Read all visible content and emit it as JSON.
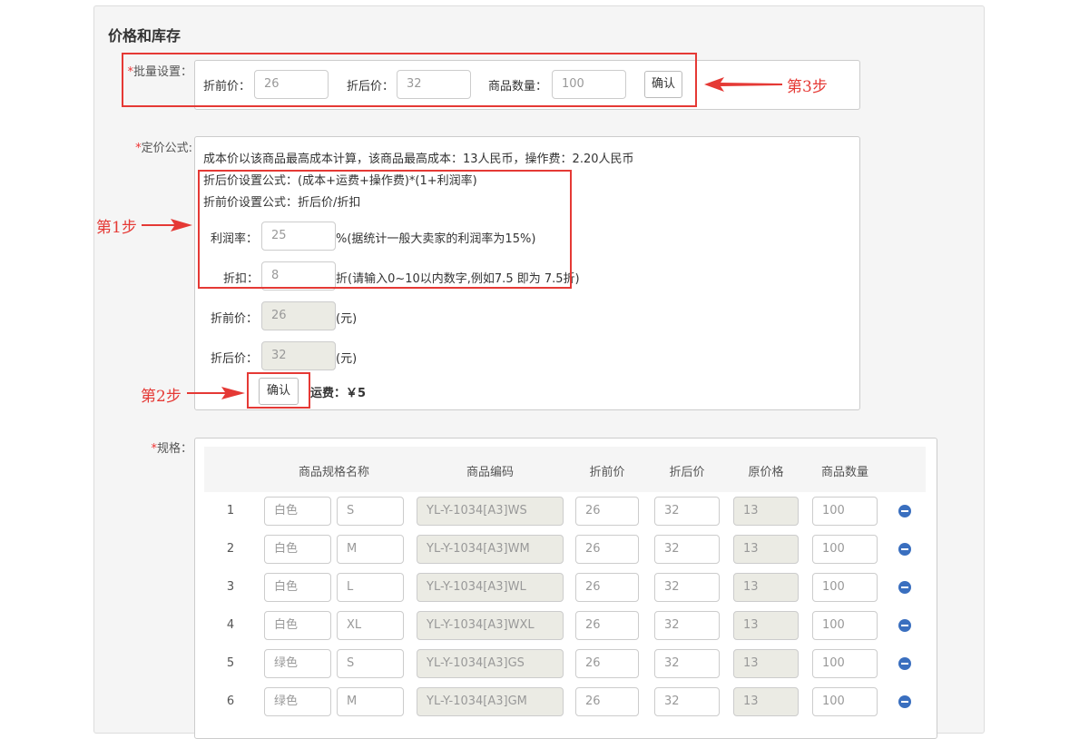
{
  "section_title": "价格和库存",
  "bulk": {
    "label": "批量设置：",
    "orig_label": "折前价：",
    "orig_value": "26",
    "disc_label": "折后价：",
    "disc_value": "32",
    "qty_label": "商品数量：",
    "qty_value": "100",
    "confirm": "确认"
  },
  "formula": {
    "label": "定价公式:",
    "line1": "成本价以该商品最高成本计算，该商品最高成本：13人民币，操作费：2.20人民币",
    "line2": "折后价设置公式：(成本+运费+操作费)*(1+利润率)",
    "line3": "折前价设置公式：折后价/折扣",
    "profit_label": "利润率：",
    "profit_value": "25",
    "profit_note": "%(据统计一般大卖家的利润率为15%)",
    "discount_label": "折扣：",
    "discount_value": "8",
    "discount_note": "折(请输入0~10以内数字,例如7.5 即为 7.5折)",
    "orig_label": "折前价：",
    "orig_value": "26",
    "orig_unit": "(元)",
    "disc_label": "折后价：",
    "disc_value": "32",
    "disc_unit": "(元)",
    "confirm": "确认",
    "shipping": "运费：￥5"
  },
  "steps": {
    "step1": "第1步",
    "step2": "第2步",
    "step3": "第3步"
  },
  "spec": {
    "label": "规格：",
    "headers": [
      "商品规格名称",
      "商品编码",
      "折前价",
      "折后价",
      "原价格",
      "商品数量"
    ],
    "rows": [
      {
        "no": "1",
        "color": "白色",
        "size": "S",
        "code": "YL-Y-1034[A3]WS",
        "orig": "26",
        "disc": "32",
        "price": "13",
        "qty": "100"
      },
      {
        "no": "2",
        "color": "白色",
        "size": "M",
        "code": "YL-Y-1034[A3]WM",
        "orig": "26",
        "disc": "32",
        "price": "13",
        "qty": "100"
      },
      {
        "no": "3",
        "color": "白色",
        "size": "L",
        "code": "YL-Y-1034[A3]WL",
        "orig": "26",
        "disc": "32",
        "price": "13",
        "qty": "100"
      },
      {
        "no": "4",
        "color": "白色",
        "size": "XL",
        "code": "YL-Y-1034[A3]WXL",
        "orig": "26",
        "disc": "32",
        "price": "13",
        "qty": "100"
      },
      {
        "no": "5",
        "color": "绿色",
        "size": "S",
        "code": "YL-Y-1034[A3]GS",
        "orig": "26",
        "disc": "32",
        "price": "13",
        "qty": "100"
      },
      {
        "no": "6",
        "color": "绿色",
        "size": "M",
        "code": "YL-Y-1034[A3]GM",
        "orig": "26",
        "disc": "32",
        "price": "13",
        "qty": "100"
      }
    ]
  },
  "colors": {
    "accent_red": "#e53935",
    "minus_blue": "#3a6fbf"
  }
}
